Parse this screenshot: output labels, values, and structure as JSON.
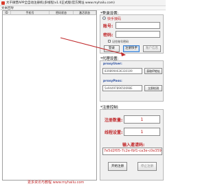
{
  "window": {
    "title": "大千微营APP全自动注册机(多线程)v1.0正式版(官方网址 www.myhailu.com)",
    "menu": "文本回导"
  },
  "table": {
    "columns": [
      "ID",
      "手机号",
      "密码状态",
      "激活状态"
    ]
  },
  "account_section": {
    "title": "*登录设置:",
    "radio_quick": "快手接码",
    "account_label": "账号:",
    "password_label": "密码:",
    "remember_label": "记住账号密码",
    "login_button": "登录",
    "register_button": "注册快手",
    "recharge_button": "账户信息"
  },
  "proxy_section": {
    "title": "*代理设置:",
    "proxy_user_label": "proxyUser:",
    "proxy_user_value": "8398994636330109",
    "get_ip_button": "获取IP地址",
    "proxy_pass_label": "proxyPass:",
    "proxy_pass_value": "5e9449789650698E",
    "check_button": "立即检测"
  },
  "register_section": {
    "title": "*注册控制:",
    "count_label": "注册数量:",
    "count_value": "1",
    "threads_label": "线程设置:",
    "threads_value": "1",
    "code_label": "输入邀请码:",
    "code_value": "7e5d2f05-7c2e-fbf1-ca3e-c0e359",
    "start_button": "开始注册",
    "stop_button": "停止注册"
  },
  "watermark": "更多资讯与教程 www.myhailu.com"
}
